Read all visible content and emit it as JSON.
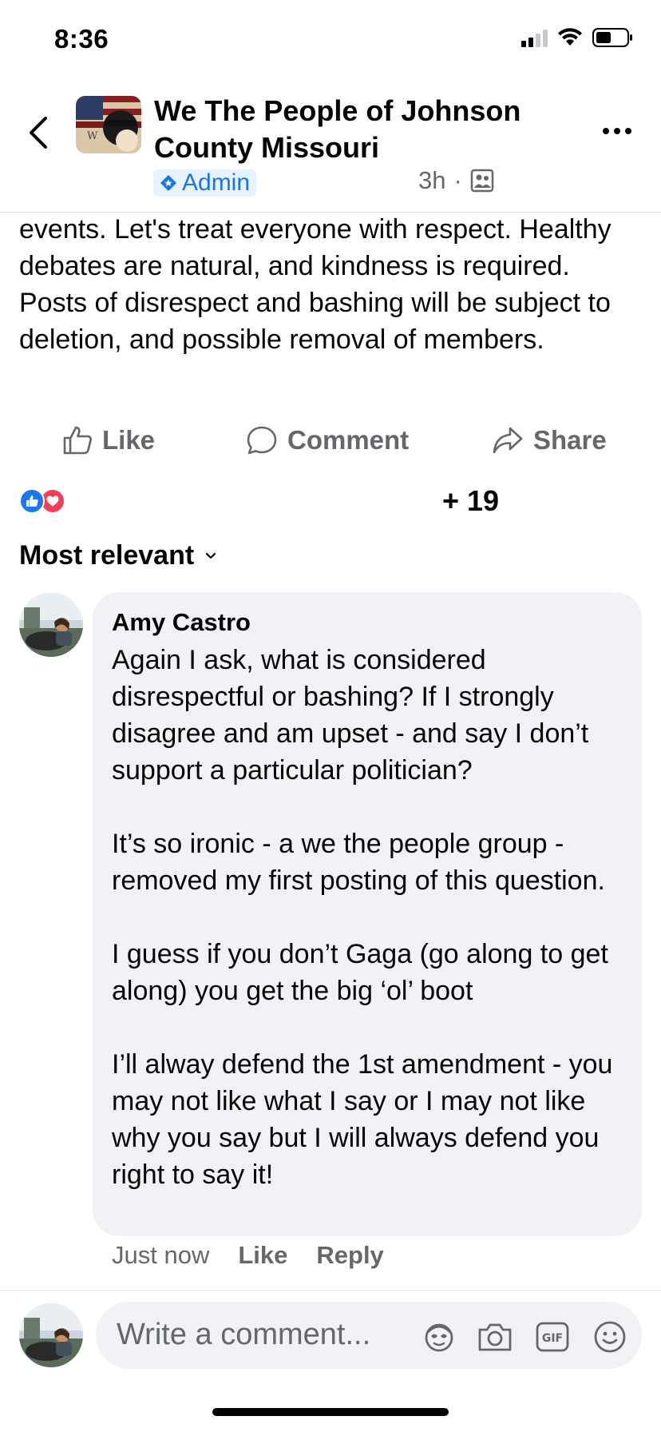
{
  "status_bar": {
    "time": "8:36"
  },
  "header": {
    "title": "We The People of Johnson County Missouri",
    "badge": "Admin",
    "time_ago": "3h",
    "separator": "·"
  },
  "post": {
    "text": "events. Let's treat everyone with respect. Healthy debates are natural, and kindness is required.  Posts of disrespect and bashing will be subject to deletion, and possible removal of members."
  },
  "actions": {
    "like": "Like",
    "comment": "Comment",
    "share": "Share"
  },
  "reactions": {
    "count": "+ 19",
    "icons": [
      "like-reaction",
      "love-reaction"
    ]
  },
  "sort": {
    "label": "Most relevant"
  },
  "comment": {
    "author": "Amy Castro",
    "text": "Again I ask, what is considered disrespectful or bashing? If I strongly disagree and am upset - and say I don’t support a particular politician?\n\nIt’s so ironic - a we the people group - removed my first posting of this question.\n\nI guess if you don’t Gaga (go along to get along) you get the big ‘ol’ boot\n\nI’ll alway defend the 1st amendment - you may not like what I say or I may not like why you say but I will always defend you right to say it!",
    "time": "Just now",
    "like": "Like",
    "reply": "Reply"
  },
  "composer": {
    "placeholder": "Write a comment...",
    "tools": [
      "avatar-sticker-icon",
      "camera-icon",
      "gif-icon",
      "emoji-icon"
    ]
  },
  "colors": {
    "accent": "#1877f2",
    "love": "#f33e58",
    "secondary_text": "#65676b",
    "bubble": "#f0f2f5"
  }
}
